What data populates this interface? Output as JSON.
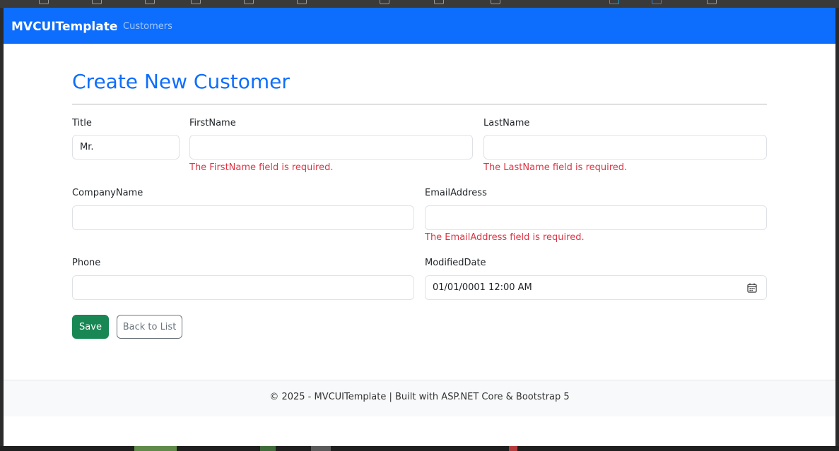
{
  "app": {
    "brand": "MVCUITemplate",
    "nav_links": [
      "Customers"
    ]
  },
  "page": {
    "title": "Create New Customer"
  },
  "form": {
    "title_field": {
      "label": "Title",
      "value": "Mr."
    },
    "first_name": {
      "label": "FirstName",
      "value": "",
      "error": "The FirstName field is required."
    },
    "last_name": {
      "label": "LastName",
      "value": "",
      "error": "The LastName field is required."
    },
    "company_name": {
      "label": "CompanyName",
      "value": ""
    },
    "email_address": {
      "label": "EmailAddress",
      "value": "",
      "error": "The EmailAddress field is required."
    },
    "phone": {
      "label": "Phone",
      "value": ""
    },
    "modified_date": {
      "label": "ModifiedDate",
      "value": "01/01/0001 12:00  AM",
      "icon": "calendar-icon"
    }
  },
  "actions": {
    "save_label": "Save",
    "back_label": "Back to List"
  },
  "footer": {
    "text": "© 2025 - MVCUITemplate | Built with ASP.NET Core & Bootstrap 5"
  },
  "colors": {
    "primary": "#0d6efd",
    "success": "#198754",
    "danger": "#dc3545",
    "secondary": "#6c757d"
  }
}
